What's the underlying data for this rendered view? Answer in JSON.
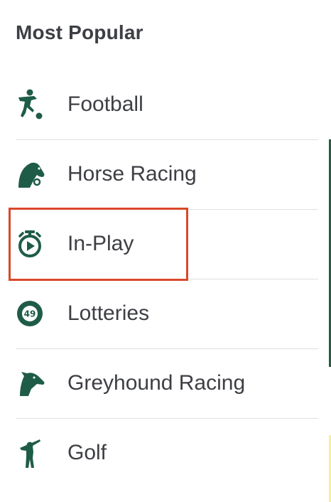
{
  "section": {
    "title": "Most Popular"
  },
  "menu": {
    "items": [
      {
        "label": "Football",
        "icon": "football-player-icon"
      },
      {
        "label": "Horse Racing",
        "icon": "horse-head-icon"
      },
      {
        "label": "In-Play",
        "icon": "stopwatch-play-icon"
      },
      {
        "label": "Lotteries",
        "icon": "lottery-ball-49-icon"
      },
      {
        "label": "Greyhound Racing",
        "icon": "greyhound-icon"
      },
      {
        "label": "Golf",
        "icon": "golfer-icon"
      }
    ],
    "highlighted_item": "In-Play"
  },
  "colors": {
    "icon": "#1f5c47",
    "text": "#3d3f44",
    "divider": "#e0e0e0",
    "highlight_border": "#d9482b"
  }
}
